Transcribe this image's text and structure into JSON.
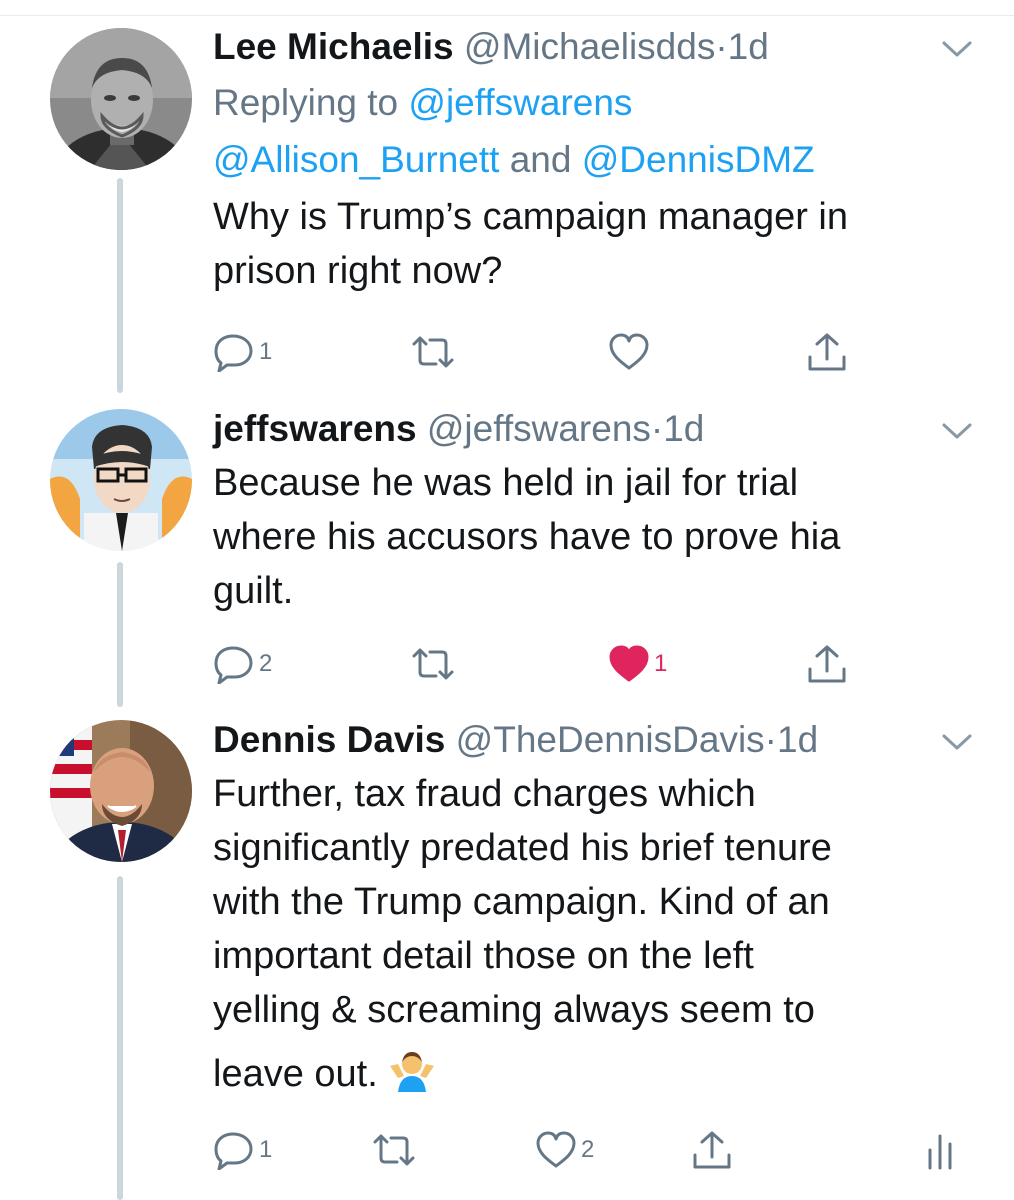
{
  "tweets": [
    {
      "name": "Lee Michaelis",
      "handle": "@Michaelisdds",
      "dot": "·",
      "time": "1d",
      "replying_prefix": "Replying to ",
      "mention_1": "@jeffswarens",
      "mention_2": "@Allison_Burnett",
      "replying_and": " and ",
      "mention_3": "@DennisDMZ",
      "text_line_1": "Why is Trump’s campaign manager in",
      "text_line_2": "prison right now?",
      "reply_count": "1",
      "retweet_count": "",
      "like_count": "",
      "liked": false
    },
    {
      "name": "jeffswarens",
      "handle": "@jeffswarens",
      "dot": "·",
      "time": "1d",
      "text_line_1": "Because he was held in jail for trial",
      "text_line_2": "where his accusors have to prove hia",
      "text_line_3": "guilt.",
      "reply_count": "2",
      "retweet_count": "",
      "like_count": "1",
      "liked": true
    },
    {
      "name": "Dennis Davis",
      "handle": "@TheDennisDavis",
      "dot": "·",
      "time": "1d",
      "text_line_1": "Further, tax fraud charges which",
      "text_line_2": "significantly predated his brief tenure",
      "text_line_3": "with the Trump campaign. Kind of an",
      "text_line_4": "important detail those on the left",
      "text_line_5": "yelling & screaming always seem to",
      "text_line_6": "leave out.",
      "emoji": "person-shrugging-emoji",
      "reply_count": "1",
      "retweet_count": "",
      "like_count": "2",
      "liked": false
    }
  ],
  "colors": {
    "text": "#14171a",
    "secondary": "#657786",
    "link": "#1da1f2",
    "like": "#e0245e",
    "thread_line": "#ccd6dd"
  },
  "icons": {
    "reply": "reply-icon",
    "retweet": "retweet-icon",
    "like": "heart-icon",
    "share": "share-icon",
    "caret": "chevron-down-icon",
    "analytics": "analytics-icon"
  }
}
